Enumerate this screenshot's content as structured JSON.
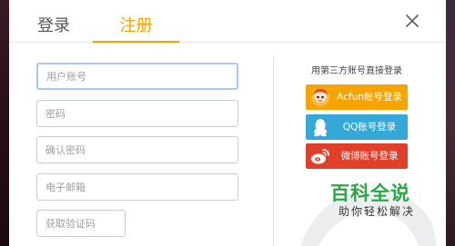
{
  "tabs": {
    "login": "登录",
    "register": "注册",
    "active": "register"
  },
  "form": {
    "username_placeholder": "用户账号",
    "password_placeholder": "密码",
    "confirm_placeholder": "确认密码",
    "email_placeholder": "电子邮箱",
    "code_placeholder": "获取验证码"
  },
  "third_party": {
    "title": "用第三方账号直接登录",
    "acfun": "Acfun账号登录",
    "qq": "QQ账号登录",
    "weibo": "微博账号登录"
  },
  "brand": {
    "logo": "百科全说",
    "tagline": "助你轻松解决"
  },
  "colors": {
    "accent": "#f5a300",
    "acfun": "#f7a400",
    "qq": "#34a9d8",
    "weibo": "#e0402a",
    "brand": "#29a846"
  },
  "icons": {
    "close": "close-icon",
    "acfun": "acfun-icon",
    "qq": "qq-penguin-icon",
    "weibo": "weibo-icon"
  }
}
